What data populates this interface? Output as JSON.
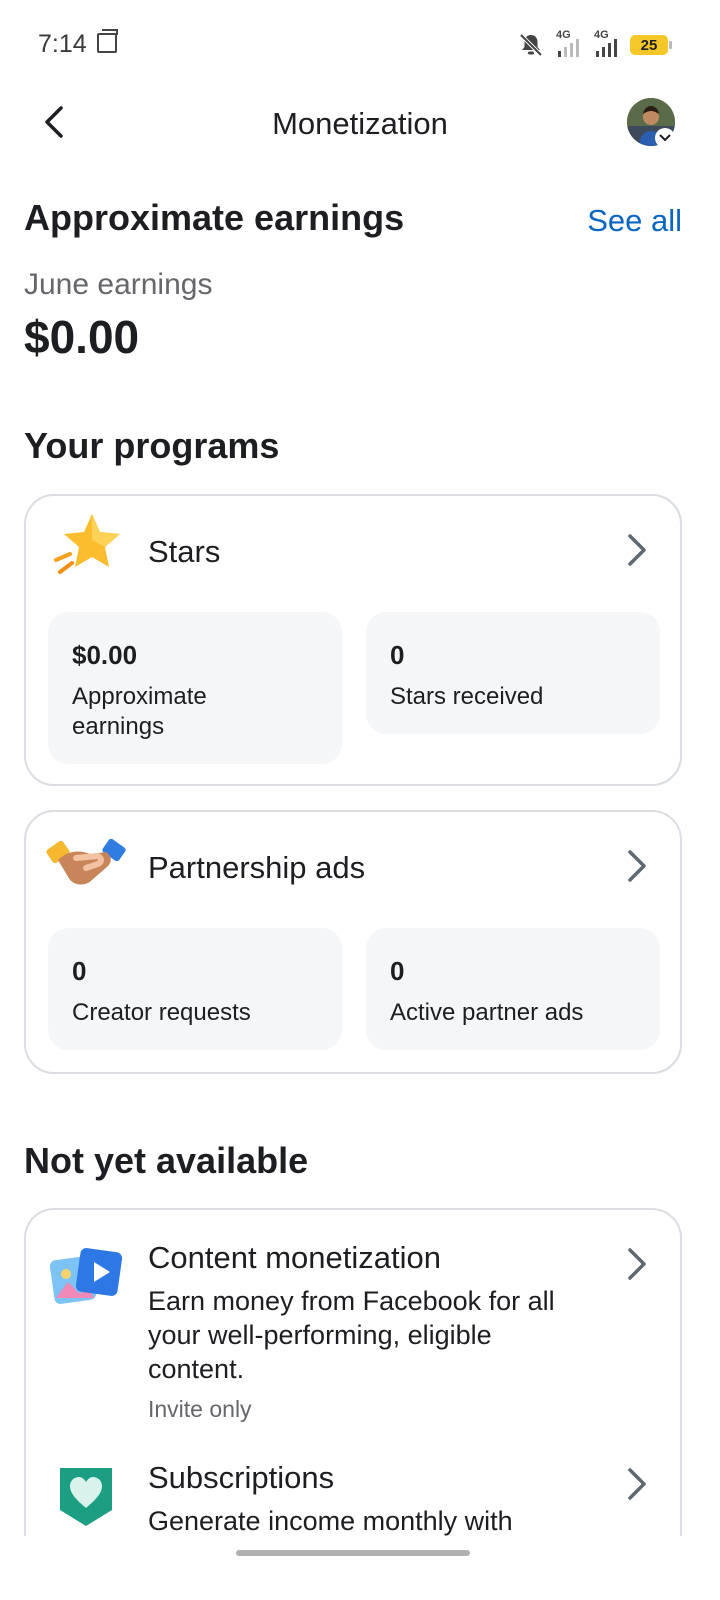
{
  "status_bar": {
    "time": "7:14",
    "network_1": "4G",
    "network_2": "4G",
    "battery": "25"
  },
  "header": {
    "title": "Monetization"
  },
  "earnings": {
    "heading": "Approximate earnings",
    "see_all": "See all",
    "period_label": "June earnings",
    "amount": "$0.00"
  },
  "programs": {
    "heading": "Your programs",
    "items": [
      {
        "title": "Stars",
        "icon": "star-icon",
        "stats": [
          {
            "value": "$0.00",
            "label": "Approximate earnings"
          },
          {
            "value": "0",
            "label": "Stars received"
          }
        ]
      },
      {
        "title": "Partnership ads",
        "icon": "handshake-icon",
        "stats": [
          {
            "value": "0",
            "label": "Creator requests"
          },
          {
            "value": "0",
            "label": "Active partner ads"
          }
        ]
      }
    ]
  },
  "not_available": {
    "heading": "Not yet available",
    "items": [
      {
        "title": "Content monetization",
        "icon": "content-media-icon",
        "description": "Earn money from Facebook for all your well-performing, eligible content.",
        "note": "Invite only"
      },
      {
        "title": "Subscriptions",
        "icon": "heart-shield-icon",
        "description": "Generate income monthly with"
      }
    ]
  },
  "colors": {
    "link": "#0a66c2",
    "card_border": "#dadde1",
    "stat_bg": "#f5f6f8",
    "secondary_text": "#65676b",
    "battery": "#f6c728"
  }
}
